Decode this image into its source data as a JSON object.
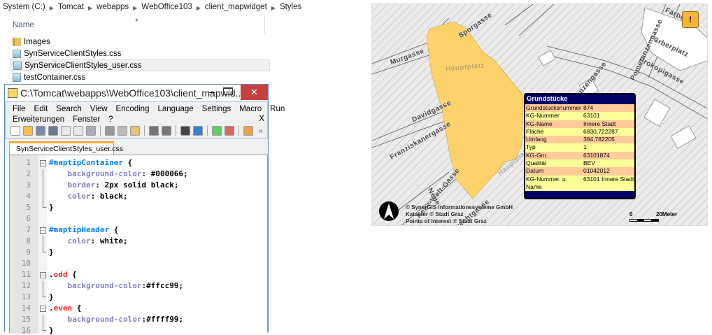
{
  "explorer": {
    "breadcrumb": [
      "System (C:)",
      "Tomcat",
      "webapps",
      "WebOffice103",
      "client_mapwidget",
      "Styles"
    ],
    "column_name": "Name",
    "files": [
      {
        "name": "Images",
        "type": "folder"
      },
      {
        "name": "SynServiceClientStyles.css",
        "type": "css"
      },
      {
        "name": "SynServiceClientStyles_user.css",
        "type": "css",
        "selected": true
      },
      {
        "name": "testContainer.css",
        "type": "css"
      }
    ]
  },
  "editor": {
    "title": "C:\\Tomcat\\webapps\\WebOffice103\\client_mapwid...",
    "minimize": "–",
    "close": "✕",
    "menu_row1": [
      "File",
      "Edit",
      "Search",
      "View",
      "Encoding",
      "Language",
      "Settings",
      "Macro",
      "Run"
    ],
    "menu_row2": [
      "Erweiterungen",
      "Fenster",
      "?"
    ],
    "menu_close": "X",
    "toolbar_more": "»",
    "tab": "SynServiceClientStyles_user.css",
    "lines": [
      [
        [
          "t-sel",
          "#maptipContainer"
        ],
        [
          "t-val",
          " {"
        ]
      ],
      [
        [
          "t-prop",
          "    background-color"
        ],
        [
          "t-val",
          ": #000066;"
        ]
      ],
      [
        [
          "t-prop",
          "    border"
        ],
        [
          "t-val",
          ": 2px solid black;"
        ]
      ],
      [
        [
          "t-prop",
          "    color"
        ],
        [
          "t-val",
          ": black;"
        ]
      ],
      [
        [
          "t-val",
          "}"
        ]
      ],
      [],
      [
        [
          "t-sel",
          "#maptipHeader"
        ],
        [
          "t-val",
          " {"
        ]
      ],
      [
        [
          "t-prop",
          "    color"
        ],
        [
          "t-val",
          ": white;"
        ]
      ],
      [
        [
          "t-val",
          "}"
        ]
      ],
      [],
      [
        [
          "t-val",
          "."
        ],
        [
          "t-cls",
          "odd"
        ],
        [
          "t-val",
          " {"
        ]
      ],
      [
        [
          "t-prop",
          "    background-color"
        ],
        [
          "t-val",
          ":#ffcc99;"
        ]
      ],
      [
        [
          "t-val",
          "}"
        ]
      ],
      [
        [
          "t-val",
          "."
        ],
        [
          "t-cls",
          "even"
        ],
        [
          "t-val",
          " {"
        ]
      ],
      [
        [
          "t-prop",
          "    background-color"
        ],
        [
          "t-val",
          ":#ffff99;"
        ]
      ],
      [
        [
          "t-val",
          "}"
        ]
      ]
    ]
  },
  "map": {
    "streets": [
      "Murgasse",
      "Sporgasse",
      "Hauptplatz",
      "Davidgasse",
      "Franziskanergasse",
      "Neue-Welt-Gasse",
      "Neue",
      "Pomeranzengasse",
      "Pomeranzengasse",
      "Färberplatz",
      "Färber",
      "Prokopigasse",
      "Hauptplatz",
      "Albrechtgasse"
    ],
    "popup": {
      "title": "Grundstücke",
      "rows": [
        [
          "Grundstücksnummer",
          "874"
        ],
        [
          "KG-Nummer",
          "63101"
        ],
        [
          "KG-Name",
          "Innere Stadt"
        ],
        [
          "Fläche",
          "6830,722287"
        ],
        [
          "Umfang",
          "384,782205"
        ],
        [
          "Typ",
          "1"
        ],
        [
          "KG-Gnr.",
          "63101874"
        ],
        [
          "Qualität",
          "BEV"
        ],
        [
          "Datum",
          "01042012"
        ],
        [
          "KG-Nummer. u. Name",
          "63101 Innere Stadt"
        ]
      ],
      "colors": {
        "border": "#000066",
        "odd": "#ffcc99",
        "even": "#ffff99",
        "header_text": "#ffffff"
      }
    },
    "copyright": [
      "© SynerGIS Informationssysteme GmbH",
      "Kataster © Stadt Graz",
      "Points of Interest © Stadt Graz"
    ],
    "scale": {
      "start": "0",
      "end": "20Meter"
    },
    "parcel_color": "#fcd36b"
  }
}
